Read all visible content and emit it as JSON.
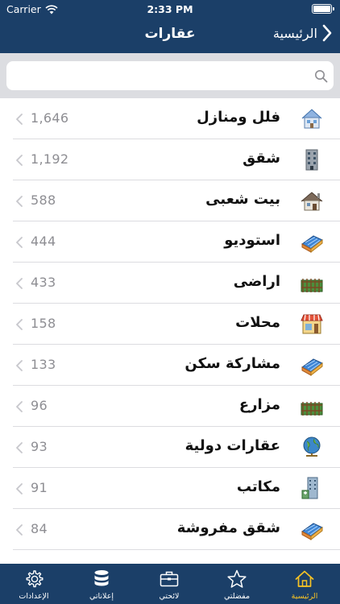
{
  "status_bar": {
    "carrier": "Carrier",
    "time": "2:33 PM"
  },
  "navbar": {
    "title": "عقارات",
    "back_label": "الرئيسية"
  },
  "search": {
    "placeholder": ""
  },
  "categories": [
    {
      "label": "فلل ومنازل",
      "count": "1,646",
      "icon": "villa-icon"
    },
    {
      "label": "شقق",
      "count": "1,192",
      "icon": "apartment-building-icon"
    },
    {
      "label": "بيت شعبى",
      "count": "588",
      "icon": "house-icon"
    },
    {
      "label": "استوديو",
      "count": "444",
      "icon": "solar-roof-icon"
    },
    {
      "label": "اراضى",
      "count": "433",
      "icon": "fenced-land-icon"
    },
    {
      "label": "محلات",
      "count": "158",
      "icon": "shop-icon"
    },
    {
      "label": "مشاركة سكن",
      "count": "133",
      "icon": "solar-roof-icon"
    },
    {
      "label": "مزارع",
      "count": "96",
      "icon": "fenced-land-icon"
    },
    {
      "label": "عقارات دولية",
      "count": "93",
      "icon": "globe-icon"
    },
    {
      "label": "مكاتب",
      "count": "91",
      "icon": "office-tower-icon"
    },
    {
      "label": "شقق مفروشة",
      "count": "84",
      "icon": "solar-roof-icon"
    }
  ],
  "tabbar": {
    "home": "الرئيسية",
    "favorites": "مفضلتي",
    "lists": "لائحتي",
    "ads": "إعلاناتي",
    "settings": "الإعدادات"
  },
  "colors": {
    "bar": "#1b3f68",
    "active_tab": "#f7c325",
    "search_bg": "#dcdde1"
  }
}
